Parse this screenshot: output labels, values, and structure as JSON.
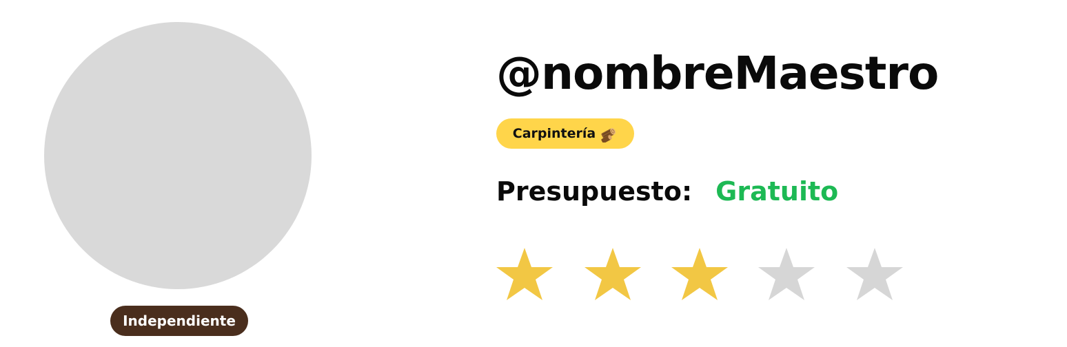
{
  "profile": {
    "username": "@nombreMaestro",
    "worker_type": "Independiente",
    "category": {
      "label": "Carpintería",
      "icon": "wood-log-icon"
    },
    "budget": {
      "label": "Presupuesto:",
      "value": "Gratuito"
    },
    "rating": {
      "value": 3,
      "max": 5
    }
  },
  "colors": {
    "avatar_placeholder": "#d9d9d9",
    "worker_type_badge": "#4a2e1d",
    "category_badge": "#ffd54a",
    "budget_value": "#1db954",
    "star_filled": "#f2c744",
    "star_empty": "#d6d6d6"
  }
}
